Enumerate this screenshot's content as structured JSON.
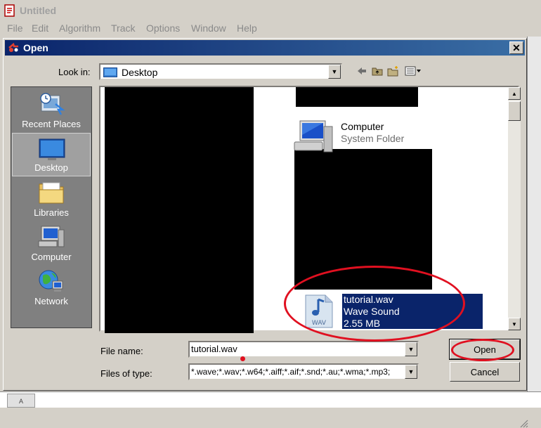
{
  "app": {
    "title": "Untitled",
    "menu": [
      "File",
      "Edit",
      "Algorithm",
      "Track",
      "Options",
      "Window",
      "Help"
    ],
    "bottom_cell": "A"
  },
  "dialog": {
    "title": "Open",
    "close_symbol": "✕",
    "look_in": {
      "label": "Look in:",
      "value": "Desktop"
    },
    "places": [
      {
        "label": "Recent Places",
        "icon": "recent-places-icon",
        "selected": false
      },
      {
        "label": "Desktop",
        "icon": "desktop-icon",
        "selected": true
      },
      {
        "label": "Libraries",
        "icon": "libraries-icon",
        "selected": false
      },
      {
        "label": "Computer",
        "icon": "computer-icon",
        "selected": false
      },
      {
        "label": "Network",
        "icon": "network-icon",
        "selected": false
      }
    ],
    "files": {
      "computer": {
        "name": "Computer",
        "type": "System Folder"
      },
      "wav": {
        "name": "tutorial.wav",
        "type": "Wave Sound",
        "size": "2.55 MB",
        "icon_text": "WAV",
        "selected": true
      }
    },
    "file_name": {
      "label": "File name:",
      "value": "tutorial.wav"
    },
    "files_of_type": {
      "label": "Files of type:",
      "value": "*.wave;*.wav;*.w64;*.aiff;*.aif;*.snd;*.au;*.wma;*.mp3;"
    },
    "buttons": {
      "open": "Open",
      "cancel": "Cancel"
    }
  },
  "colors": {
    "selection": "#0a246a",
    "annotation": "#e01020",
    "title_gradient_start": "#0a246a",
    "title_gradient_end": "#3a6ea5"
  }
}
